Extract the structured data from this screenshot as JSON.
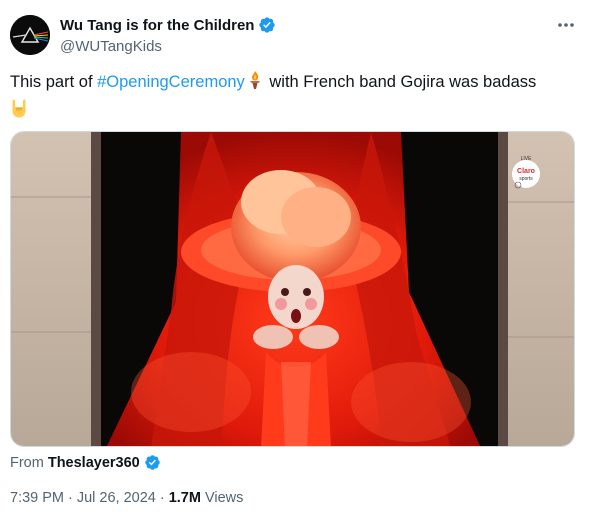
{
  "author": {
    "display_name": "Wu Tang is for the Children",
    "handle": "@WUTangKids",
    "verified": true,
    "avatar_icon": "avatar-image"
  },
  "tweet": {
    "text_before": "This part of ",
    "hashtag": "#OpeningCeremony",
    "text_after": " with French band Gojira was badass",
    "emoji_torch": "torch-emoji",
    "emoji_horns": "sign-of-horns-emoji"
  },
  "media": {
    "overlay_badge_text": "Claro sports",
    "overlay_badge_small": "LIVE"
  },
  "attribution": {
    "from_label": "From",
    "from_user": "Theslayer360",
    "verified": true
  },
  "meta": {
    "time": "7:39 PM",
    "separator": "·",
    "date": "Jul 26, 2024",
    "views_count": "1.7M",
    "views_label": "Views"
  },
  "colors": {
    "accent": "#1d9bf0",
    "text_primary": "#0f1419",
    "text_secondary": "#536471"
  }
}
